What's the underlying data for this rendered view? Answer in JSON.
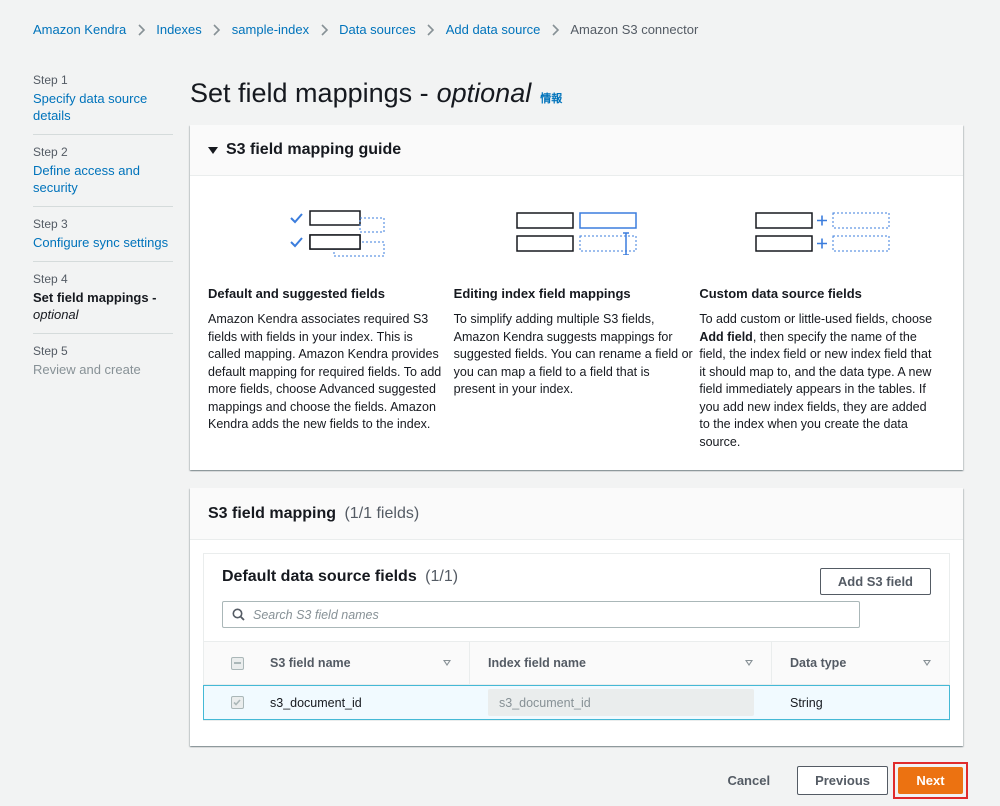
{
  "breadcrumb": [
    {
      "label": "Amazon Kendra",
      "link": true
    },
    {
      "label": "Indexes",
      "link": true
    },
    {
      "label": "sample-index",
      "link": true
    },
    {
      "label": "Data sources",
      "link": true
    },
    {
      "label": "Add data source",
      "link": true
    },
    {
      "label": "Amazon S3 connector",
      "link": false
    }
  ],
  "steps": [
    {
      "num": "Step 1",
      "title": "Specify data source details",
      "state": "link"
    },
    {
      "num": "Step 2",
      "title": "Define access and security",
      "state": "link"
    },
    {
      "num": "Step 3",
      "title": "Configure sync settings",
      "state": "link"
    },
    {
      "num": "Step 4",
      "title": "Set field mappings -",
      "title_italic": "optional",
      "state": "active"
    },
    {
      "num": "Step 5",
      "title": "Review and create",
      "state": "disabled"
    }
  ],
  "header": {
    "title": "Set field mappings -",
    "title_italic": "optional",
    "info": "情報"
  },
  "guide": {
    "title": "S3 field mapping guide",
    "columns": [
      {
        "heading": "Default and suggested fields",
        "body": "Amazon Kendra associates required S3 fields with fields in your index. This is called mapping. Amazon Kendra provides default mapping for required fields. To add more fields, choose Advanced suggested mappings and choose the fields. Amazon Kendra adds the new fields to the index."
      },
      {
        "heading": "Editing index field mappings",
        "body": "To simplify adding multiple S3 fields, Amazon Kendra suggests mappings for suggested fields. You can rename a field or you can map a field to a field that is present in your index."
      },
      {
        "heading": "Custom data source fields",
        "body_pre": "To add custom or little-used fields, choose ",
        "body_bold": "Add field",
        "body_post": ", then specify the name of the field, the index field or new index field that it should map to, and the data type. A new field immediately appears in the tables. If you add new index fields, they are added to the index when you create the data source."
      }
    ]
  },
  "mapping": {
    "title": "S3 field mapping",
    "count": "(1/1 fields)",
    "default_fields": {
      "title": "Default data source fields",
      "count": "(1/1)",
      "add_button": "Add S3 field",
      "search_placeholder": "Search S3 field names",
      "columns": [
        "S3 field name",
        "Index field name",
        "Data type"
      ],
      "rows": [
        {
          "s3_field": "s3_document_id",
          "index_field": "s3_document_id",
          "data_type": "String"
        }
      ]
    }
  },
  "footer": {
    "cancel": "Cancel",
    "previous": "Previous",
    "next": "Next"
  },
  "colors": {
    "link": "#0073bb",
    "primary": "#ec7211",
    "highlight": "#e02b2b"
  }
}
